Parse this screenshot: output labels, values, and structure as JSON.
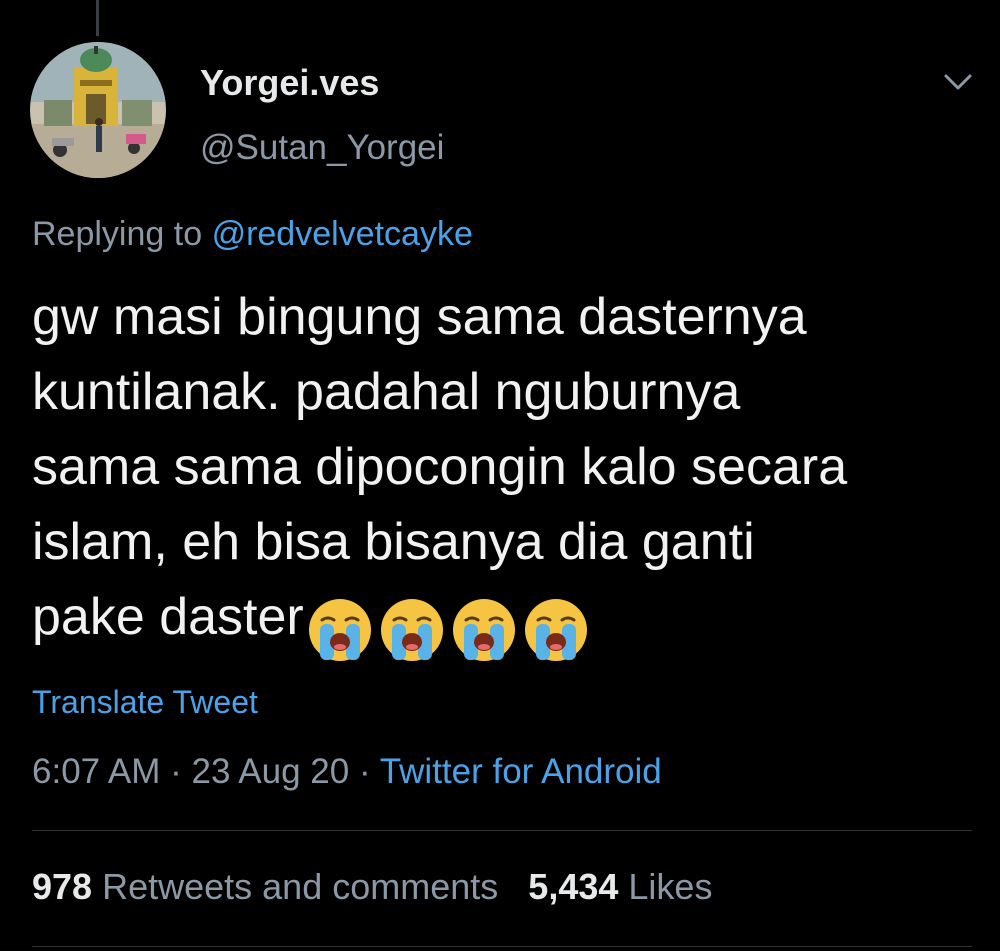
{
  "user": {
    "display_name": "Yorgei.ves",
    "handle": "@Sutan_Yorgei",
    "avatar_icon": "avatar-photo"
  },
  "reply": {
    "prefix": "Replying to",
    "mention": "@redvelvetcayke"
  },
  "tweet": {
    "text": "gw masi bingung sama dasternya\nkuntilanak. padahal nguburnya\nsama sama dipocongin kalo secara\nislam, eh bisa bisanya dia ganti\npake daster",
    "emojis": [
      "loudly-crying-face",
      "loudly-crying-face",
      "loudly-crying-face",
      "loudly-crying-face"
    ]
  },
  "translate_label": "Translate Tweet",
  "meta": {
    "time": "6:07 AM",
    "separator": "·",
    "date": "23 Aug 20",
    "source": "Twitter for Android"
  },
  "stats": {
    "retweets_count": "978",
    "retweets_label": "Retweets and comments",
    "likes_count": "5,434",
    "likes_label": "Likes"
  },
  "colors": {
    "background": "#000000",
    "accent": "#4aa3e8",
    "secondary_text": "#8b98a5",
    "primary_text": "#e7e9ea"
  }
}
